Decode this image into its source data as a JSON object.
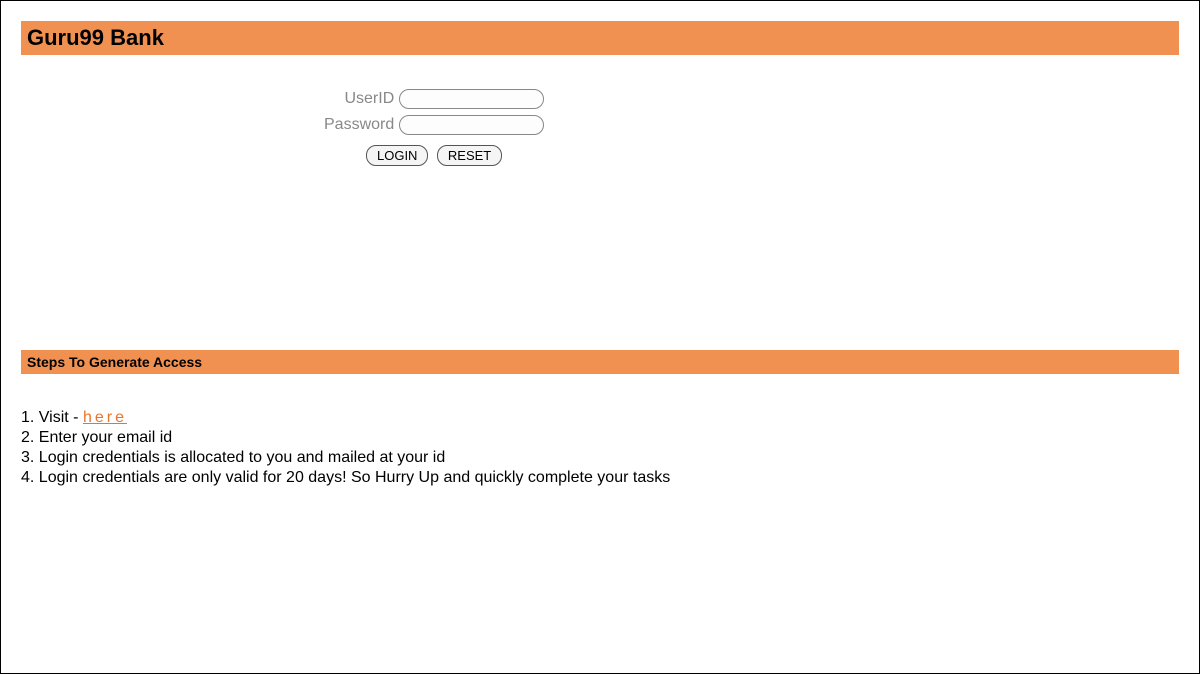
{
  "header": {
    "title": "Guru99 Bank"
  },
  "login": {
    "userid_label": "UserID",
    "password_label": "Password",
    "userid_value": "",
    "password_value": "",
    "login_button": "LOGIN",
    "reset_button": "RESET"
  },
  "steps": {
    "title": "Steps To Generate Access",
    "items": [
      {
        "prefix": "1. Visit - ",
        "link_text": "here",
        "suffix": ""
      },
      {
        "prefix": "2. Enter your email id",
        "link_text": "",
        "suffix": ""
      },
      {
        "prefix": "3. Login credentials is allocated to you and mailed at your id",
        "link_text": "",
        "suffix": ""
      },
      {
        "prefix": "4. Login credentials are only valid for 20 days! So Hurry Up and quickly complete your tasks",
        "link_text": "",
        "suffix": ""
      }
    ]
  },
  "colors": {
    "accent": "#f09152",
    "link": "#e8742c"
  }
}
